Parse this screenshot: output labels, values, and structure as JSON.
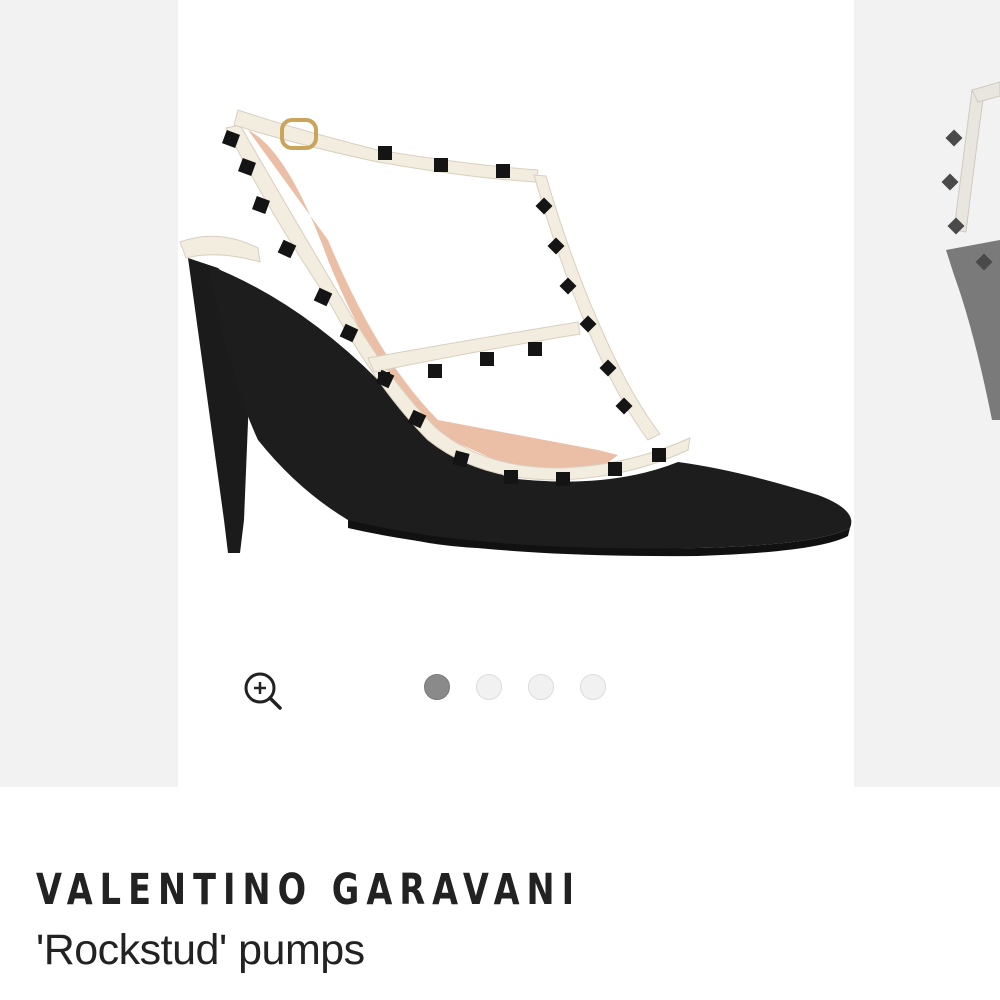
{
  "carousel": {
    "images": [
      {
        "name": "product-image-1",
        "active": true
      },
      {
        "name": "product-image-2",
        "active": false
      },
      {
        "name": "product-image-3",
        "active": false
      },
      {
        "name": "product-image-4",
        "active": false
      }
    ],
    "zoom_icon": "zoom-in-icon"
  },
  "product": {
    "brand": "VALENTINO GARAVANI",
    "name": "'Rockstud' pumps"
  },
  "colors": {
    "text": "#222222",
    "dot_active": "#8a8a8a",
    "dot_inactive": "#f1f1f1",
    "carousel_bg": "#f3f3f3"
  }
}
